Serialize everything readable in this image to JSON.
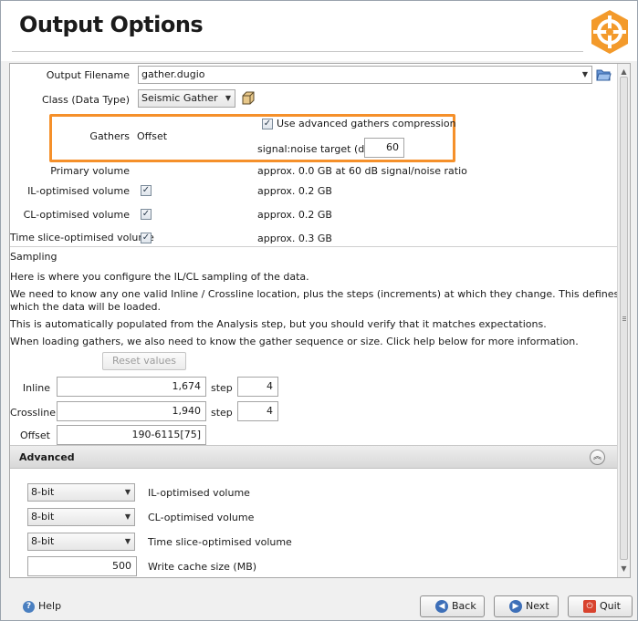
{
  "window": {
    "title": "Output Options"
  },
  "output": {
    "filename_label": "Output Filename",
    "filename_value": "gather.dugio",
    "class_label": "Class (Data Type)",
    "class_value": "Seismic Gather"
  },
  "gathers": {
    "label": "Gathers",
    "value": "Offset",
    "compression_label": "Use advanced gathers compression",
    "compression_checked": true,
    "snr_label": "signal:noise target (dB)",
    "snr_value": "60"
  },
  "volumes": {
    "primary_label": "Primary volume",
    "primary_note": "approx. 0.0 GB at 60 dB signal/noise ratio",
    "il_label": "IL-optimised volume",
    "il_checked": true,
    "il_note": "approx. 0.2 GB",
    "cl_label": "CL-optimised volume",
    "cl_checked": true,
    "cl_note": "approx. 0.2 GB",
    "ts_label": "Time slice-optimised volume",
    "ts_checked": true,
    "ts_note": "approx. 0.3 GB"
  },
  "sampling": {
    "heading": "Sampling",
    "line1": "Here is where you configure the IL/CL sampling of the data.",
    "line2a": "We need to know any one valid Inline / Crossline location, plus the steps (increments) at which they change. This defines the grid on",
    "line2b": "which the data will be loaded.",
    "line3": "This is automatically populated from the Analysis step, but you should verify that it matches expectations.",
    "line4": "When loading gathers, we also need to know the gather sequence or size.  Click help below for more information.",
    "reset_label": "Reset values",
    "inline_label": "Inline",
    "inline_value": "1,674",
    "inline_step_label": "step",
    "inline_step_value": "4",
    "crossline_label": "Crossline",
    "crossline_value": "1,940",
    "crossline_step_label": "step",
    "crossline_step_value": "4",
    "offset_label": "Offset",
    "offset_value": "190-6115[75]"
  },
  "advanced": {
    "title": "Advanced",
    "il_bits": "8-bit",
    "il_label": "IL-optimised volume",
    "cl_bits": "8-bit",
    "cl_label": "CL-optimised volume",
    "ts_bits": "8-bit",
    "ts_label": "Time slice-optimised volume",
    "cache_value": "500",
    "cache_label": "Write cache size (MB)"
  },
  "footer": {
    "help_label": "Help",
    "back_label": "Back",
    "next_label": "Next",
    "quit_label": "Quit"
  },
  "colors": {
    "highlight": "#f5902a",
    "logo": "#f39a2b",
    "back_icon": "#3d6fb8",
    "next_icon": "#3d6fb8",
    "quit_icon": "#d8432e"
  }
}
